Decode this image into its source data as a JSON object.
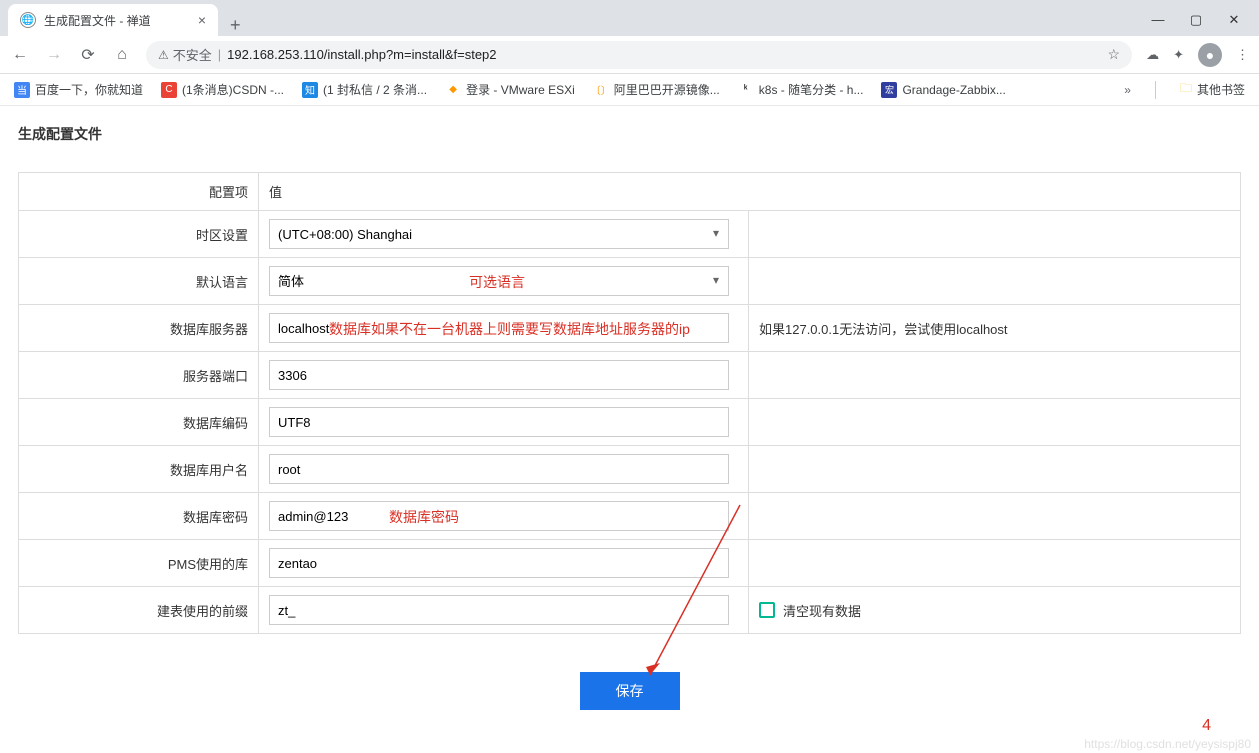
{
  "browser": {
    "tab_title": "生成配置文件 - 禅道",
    "insecure_label": "不安全",
    "url": "192.168.253.110/install.php?m=install&f=step2",
    "window": {
      "min": "—",
      "max": "▢",
      "close": "✕"
    }
  },
  "bookmarks": {
    "items": [
      {
        "label": "百度一下，你就知道",
        "icon": "blue",
        "glyph": "当"
      },
      {
        "label": "(1条消息)CSDN -...",
        "icon": "red",
        "glyph": "C"
      },
      {
        "label": "(1 封私信 / 2 条消...",
        "icon": "ztblue",
        "glyph": "知"
      },
      {
        "label": "登录 - VMware ESXi",
        "icon": "orange",
        "glyph": "◆"
      },
      {
        "label": "阿里巴巴开源镜像...",
        "icon": "orange",
        "glyph": "〔〕"
      },
      {
        "label": "k8s - 随笔分类 - h...",
        "icon": "kblack",
        "glyph": "ᵏ"
      },
      {
        "label": "Grandage-Zabbix...",
        "icon": "darkblue",
        "glyph": "宏"
      }
    ],
    "more": "»",
    "other": "其他书签"
  },
  "page": {
    "title": "生成配置文件",
    "header_item": "配置项",
    "header_value": "值",
    "rows": {
      "timezone": {
        "label": "时区设置",
        "value": "(UTC+08:00) Shanghai"
      },
      "language": {
        "label": "默认语言",
        "value": "简体",
        "annotation": "可选语言"
      },
      "dbhost": {
        "label": "数据库服务器",
        "value": "localhost",
        "annotation": "数据库如果不在一台机器上则需要写数据库地址服务器的ip",
        "hint": "如果127.0.0.1无法访问，尝试使用localhost"
      },
      "port": {
        "label": "服务器端口",
        "value": "3306"
      },
      "encoding": {
        "label": "数据库编码",
        "value": "UTF8"
      },
      "dbuser": {
        "label": "数据库用户名",
        "value": "root"
      },
      "dbpass": {
        "label": "数据库密码",
        "value": "admin@123",
        "annotation": "数据库密码"
      },
      "dbname": {
        "label": "PMS使用的库",
        "value": "zentao"
      },
      "prefix": {
        "label": "建表使用的前缀",
        "value": "zt_",
        "checkbox_label": "清空现有数据"
      }
    },
    "save_button": "保存",
    "page_number": "4",
    "watermark": "https://blog.csdn.net/yeysispj80"
  }
}
